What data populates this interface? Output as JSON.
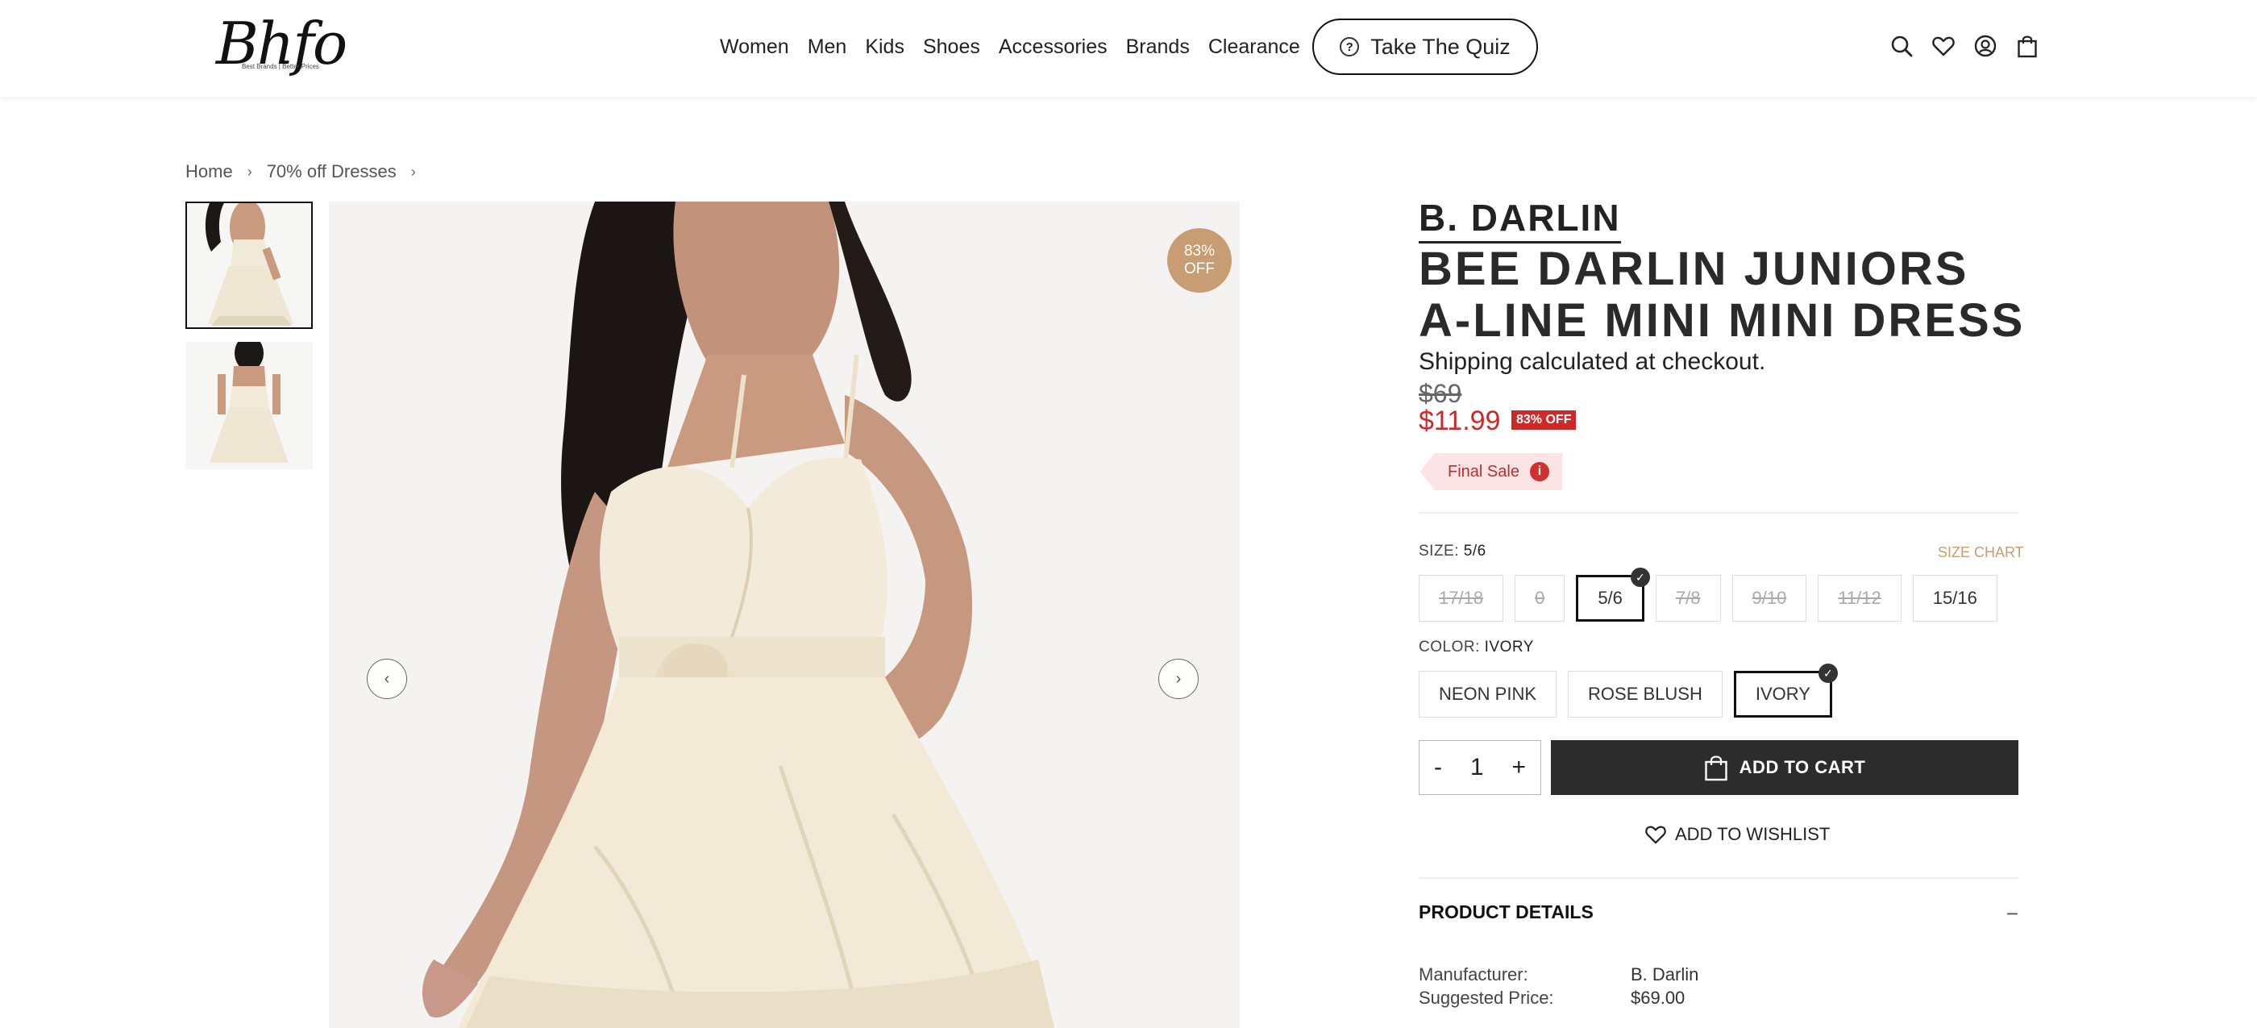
{
  "header": {
    "logo_text": "Bhfo",
    "logo_tagline": "Best Brands | Better Prices",
    "nav": [
      "Women",
      "Men",
      "Kids",
      "Shoes",
      "Accessories",
      "Brands",
      "Clearance"
    ],
    "quiz_label": "Take The Quiz",
    "icons": [
      "search-icon",
      "heart-icon",
      "account-icon",
      "bag-icon"
    ]
  },
  "breadcrumb": {
    "items": [
      "Home",
      "70% off Dresses"
    ]
  },
  "gallery": {
    "badge_line1": "83%",
    "badge_line2": "OFF",
    "thumbnail_count": 2
  },
  "product": {
    "brand": "B. DARLIN",
    "title": "BEE DARLIN JUNIORS A-LINE MINI MINI DRESS",
    "shipping": "Shipping calculated at checkout.",
    "price_old": "$69",
    "price_new": "$11.99",
    "off_tag": "83% OFF",
    "final_sale": "Final Sale",
    "size": {
      "label": "SIZE:",
      "selected": "5/6",
      "chart_label": "SIZE CHART",
      "options": [
        {
          "label": "17/18",
          "disabled": true,
          "selected": false
        },
        {
          "label": "0",
          "disabled": true,
          "selected": false
        },
        {
          "label": "5/6",
          "disabled": false,
          "selected": true
        },
        {
          "label": "7/8",
          "disabled": true,
          "selected": false
        },
        {
          "label": "9/10",
          "disabled": true,
          "selected": false
        },
        {
          "label": "11/12",
          "disabled": true,
          "selected": false
        },
        {
          "label": "15/16",
          "disabled": false,
          "selected": false
        }
      ]
    },
    "color": {
      "label": "COLOR:",
      "selected": "IVORY",
      "options": [
        {
          "label": "NEON PINK",
          "selected": false
        },
        {
          "label": "ROSE BLUSH",
          "selected": false
        },
        {
          "label": "IVORY",
          "selected": true
        }
      ]
    },
    "quantity": "1",
    "qty_minus": "-",
    "qty_plus": "+",
    "add_to_cart": "ADD TO CART",
    "add_to_wishlist": "ADD TO WISHLIST",
    "details_heading": "PRODUCT DETAILS",
    "details_toggle": "−",
    "specs": [
      {
        "label": "Manufacturer:",
        "value": "B. Darlin"
      },
      {
        "label": "Suggested Price:",
        "value": "$69.00"
      }
    ]
  },
  "colors": {
    "accent_tan": "#c99d74",
    "sale_red": "#d02828",
    "button_dark": "#2c2c2c"
  }
}
